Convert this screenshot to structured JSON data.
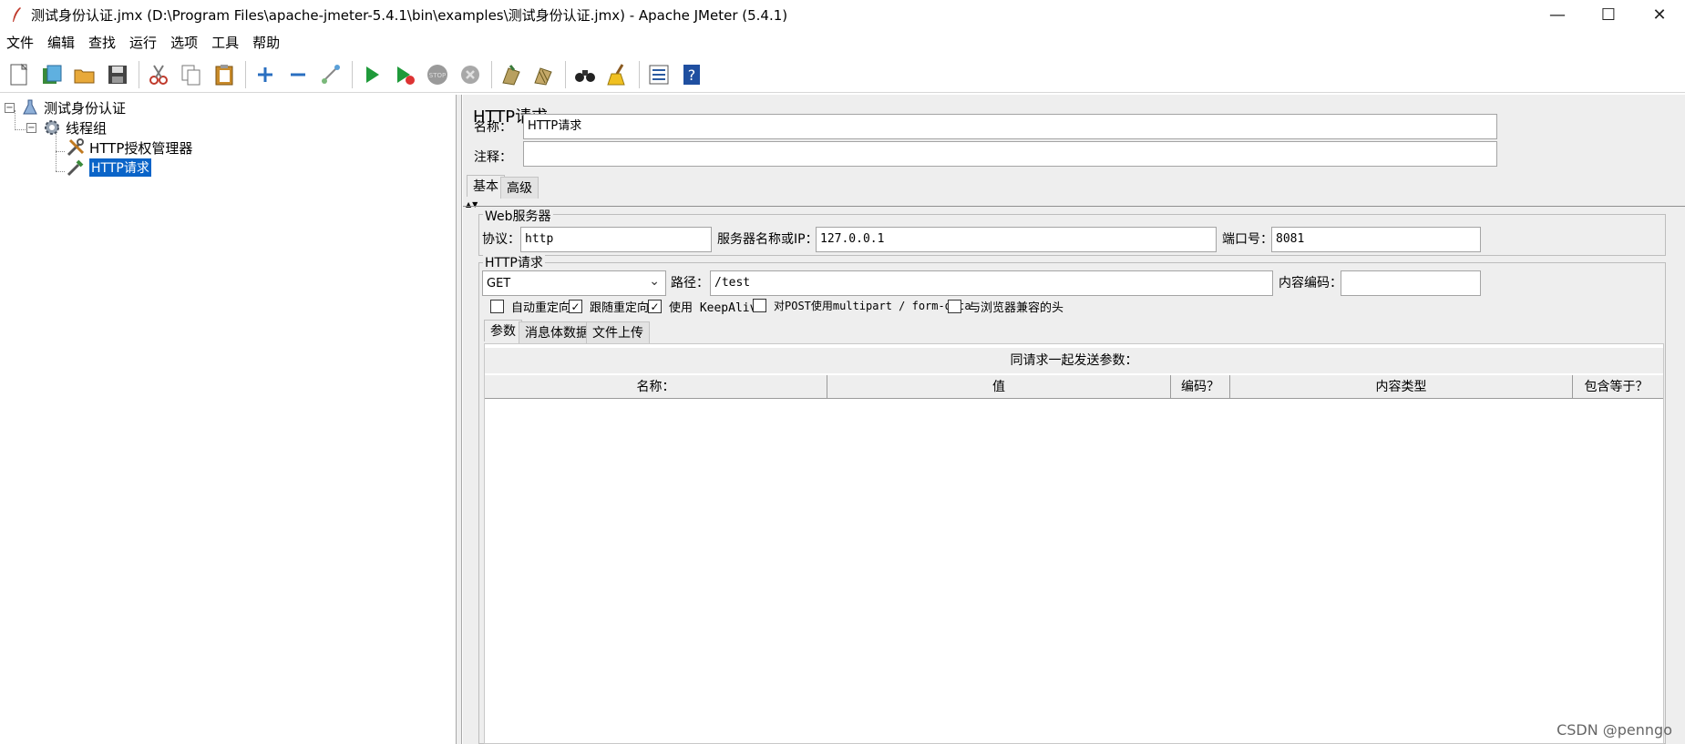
{
  "window": {
    "title": "测试身份认证.jmx (D:\\Program Files\\apache-jmeter-5.4.1\\bin\\examples\\测试身份认证.jmx) - Apache JMeter (5.4.1)",
    "minimize": "—",
    "maximize": "☐",
    "close": "✕"
  },
  "menu": [
    "文件",
    "编辑",
    "查找",
    "运行",
    "选项",
    "工具",
    "帮助"
  ],
  "tree": {
    "items": [
      {
        "label": "测试身份认证",
        "toggle": "−"
      },
      {
        "label": "线程组",
        "toggle": "−"
      },
      {
        "label": "HTTP授权管理器"
      },
      {
        "label": "HTTP请求"
      }
    ]
  },
  "editor": {
    "title": "HTTP请求",
    "name_label": "名称：",
    "name_value": "HTTP请求",
    "comment_label": "注释：",
    "comment_value": "",
    "tabs": [
      "基本",
      "高级"
    ],
    "web_server": {
      "group_title": "Web服务器",
      "protocol_label": "协议：",
      "protocol_value": "http",
      "server_label": "服务器名称或IP：",
      "server_value": "127.0.0.1",
      "port_label": "端口号：",
      "port_value": "8081"
    },
    "http_request": {
      "group_title": "HTTP请求",
      "method": "GET",
      "path_label": "路径：",
      "path_value": "/test",
      "encoding_label": "内容编码：",
      "encoding_value": "",
      "checkboxes": [
        {
          "label": "自动重定向",
          "checked": false
        },
        {
          "label": "跟随重定向",
          "checked": true
        },
        {
          "label": "使用 KeepAlive",
          "checked": true
        },
        {
          "label": "对POST使用multipart / form-data",
          "checked": false
        },
        {
          "label": "与浏览器兼容的头",
          "checked": false
        }
      ]
    },
    "sub_tabs": [
      "参数",
      "消息体数据",
      "文件上传"
    ],
    "params": {
      "caption": "同请求一起发送参数：",
      "columns": [
        "名称：",
        "值",
        "编码？",
        "内容类型",
        "包含等于？"
      ]
    }
  },
  "watermark": "CSDN @penngo"
}
